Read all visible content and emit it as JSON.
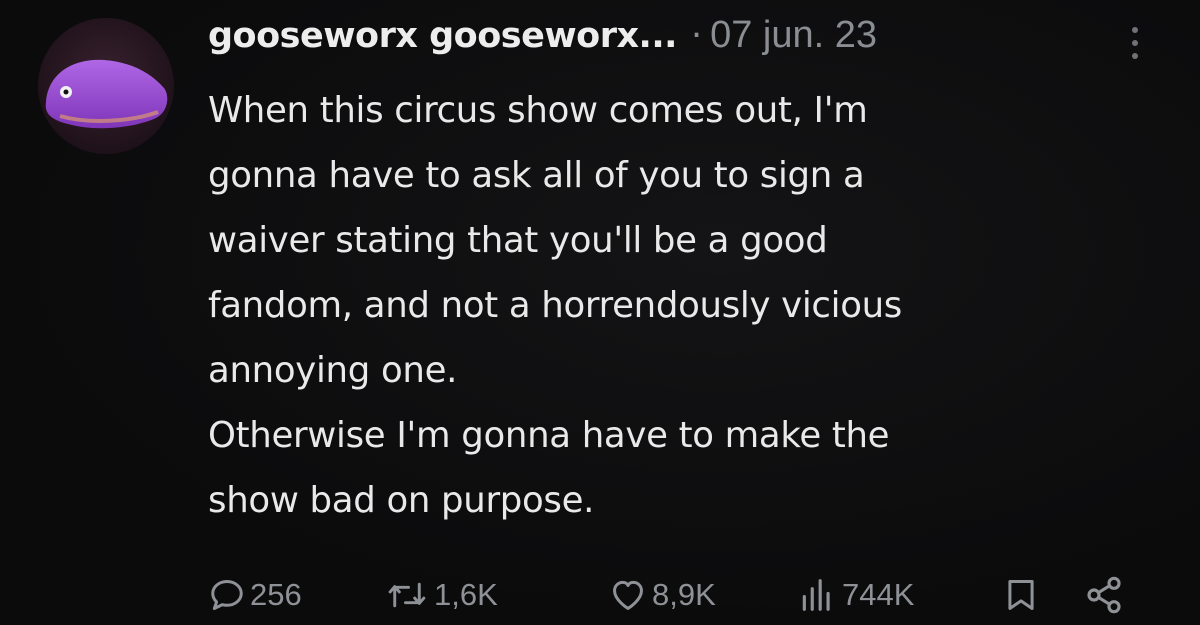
{
  "post": {
    "author_name": "gooseworx gooseworx...",
    "separator": "·",
    "date": "07 jun. 23",
    "body_lines": [
      "When this circus show comes out, I'm",
      "gonna have to ask all of you to sign a",
      "waiver stating that you'll be a good",
      "fandom, and not a horrendously vicious",
      "annoying one.",
      "Otherwise I'm gonna have to make the",
      "show bad on purpose."
    ]
  },
  "actions": {
    "replies": "256",
    "reposts": "1,6K",
    "likes": "8,9K",
    "views": "744K"
  },
  "icons": {
    "avatar": "purple-creature-avatar",
    "more": "more-options-icon",
    "reply": "reply-icon",
    "repost": "repost-icon",
    "like": "heart-icon",
    "views": "views-chart-icon",
    "bookmark": "bookmark-icon",
    "share": "share-icon"
  },
  "colors": {
    "background": "#0c0c0d",
    "text": "#e9e9e9",
    "muted": "#8e9196",
    "avatar_accent": "#9b4fd0"
  }
}
